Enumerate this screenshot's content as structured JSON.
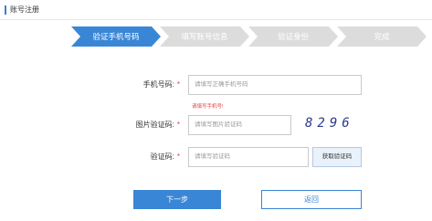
{
  "header": {
    "title": "账号注册"
  },
  "steps": [
    {
      "label": "验证手机号码",
      "state": "active"
    },
    {
      "label": "填写账号信息",
      "state": "inactive"
    },
    {
      "label": "验证身份",
      "state": "inactive"
    },
    {
      "label": "完成",
      "state": "inactive"
    }
  ],
  "colors": {
    "active_step": "#3a86d6",
    "inactive_step": "#dcdcdc",
    "required": "#e63a3a",
    "accent": "#3a86d6"
  },
  "form": {
    "phone": {
      "label": "手机号码:",
      "required": "*",
      "placeholder": "请填写正确手机号码",
      "error": "请填写手机号!"
    },
    "image_code": {
      "label": "图片验证码:",
      "required": "*",
      "placeholder": "请填写图片验证码",
      "captcha": "8296"
    },
    "sms_code": {
      "label": "验证码:",
      "required": "*",
      "placeholder": "请填写验证码",
      "button": "获取验证码"
    }
  },
  "actions": {
    "next": "下一步",
    "back": "返回"
  }
}
